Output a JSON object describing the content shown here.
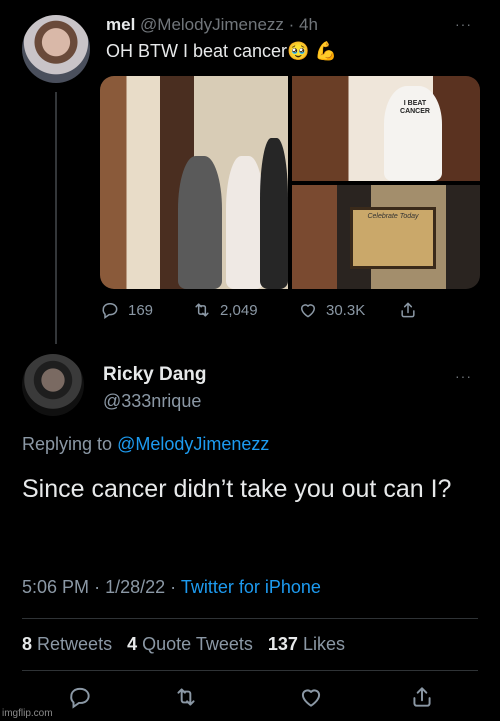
{
  "tweet1": {
    "name": "mel",
    "handle": "@MelodyJimenezz",
    "time": "4h",
    "separator": "·",
    "text": "OH BTW I beat cancer",
    "emoji": "🥹 💪",
    "stats": {
      "replies": "169",
      "retweets": "2,049",
      "likes": "30.3K"
    },
    "photo_sign_text": "I BEAT CANCER",
    "plaque_text": "Celebrate Today"
  },
  "tweet2": {
    "name": "Ricky Dang",
    "handle": "@333nrique",
    "replying_prefix": "Replying to",
    "replying_to": "@MelodyJimenezz",
    "text": "Since cancer didn’t take you out can I?",
    "time": "5:06 PM",
    "date": "1/28/22",
    "source": "Twitter for iPhone",
    "separator": "·",
    "retweets_count": "8",
    "retweets_label": "Retweets",
    "quotes_count": "4",
    "quotes_label": "Quote Tweets",
    "likes_count": "137",
    "likes_label": "Likes"
  },
  "more_glyph": "···",
  "watermark": "imgflip.com",
  "colors": {
    "background": "#000000",
    "text": "#e7e9ea",
    "muted": "#8b98a5",
    "link": "#1d9bf0",
    "divider": "#2f3336"
  },
  "icons": [
    "reply-icon",
    "retweet-icon",
    "like-icon",
    "share-icon",
    "more-icon"
  ]
}
